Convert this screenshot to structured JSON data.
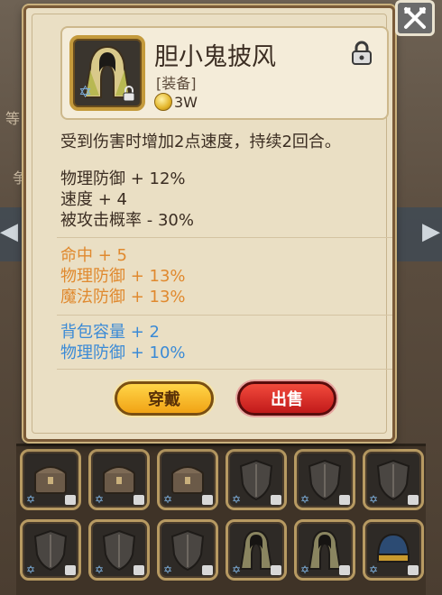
{
  "item": {
    "name": "胆小鬼披风",
    "type": "[装备]",
    "price": "3W",
    "description": "受到伤害时增加2点速度，持续2回合。"
  },
  "stats": {
    "base": [
      "物理防御 + 12%",
      "速度 + 4",
      "被攻击概率 - 30%"
    ],
    "orange": [
      "命中 + 5",
      "物理防御 + 13%",
      "魔法防御 + 13%"
    ],
    "blue": [
      "背包容量 + 2",
      "物理防御 + 10%"
    ]
  },
  "buttons": {
    "wear": "穿戴",
    "sell": "出售"
  },
  "background_text": {
    "left_1": "等",
    "left_2": "争"
  },
  "icons": {
    "close": "crossed-swords-icon",
    "lock": "padlock-icon",
    "coin": "gold-coin-icon",
    "star": "blue-star-icon"
  },
  "inventory": {
    "row1": [
      "treasure-chest",
      "treasure-chest",
      "treasure-chest",
      "shield",
      "shield",
      "shield"
    ],
    "row2": [
      "shield",
      "shield",
      "shield",
      "cloak",
      "cloak",
      "helmet"
    ]
  },
  "colors": {
    "panel": "#eadfc4",
    "stat_orange": "#e0892e",
    "stat_blue": "#3a8ad6",
    "wear_button": "#f1a315",
    "sell_button": "#c11a1a"
  }
}
